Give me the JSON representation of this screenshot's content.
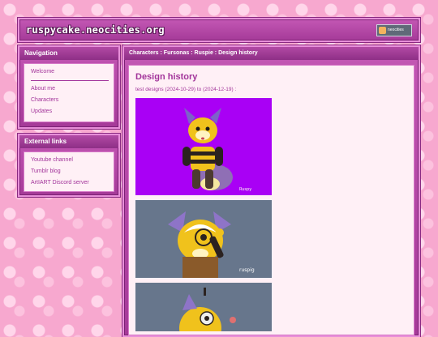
{
  "header": {
    "site_title": "ruspycake.neocities.org",
    "badge_label": "neocities"
  },
  "navigation": {
    "heading": "Navigation",
    "items": [
      {
        "label": "Welcome"
      },
      {
        "label": "About me"
      },
      {
        "label": "Characters"
      },
      {
        "label": "Updates"
      }
    ]
  },
  "external_links": {
    "heading": "External links",
    "items": [
      {
        "label": "Youtube channel"
      },
      {
        "label": "Tumblr blog"
      },
      {
        "label": "ArtIART Discord server"
      }
    ]
  },
  "main": {
    "breadcrumb": "Characters : Fursonas : Ruspie : Design history",
    "title": "Design history",
    "subtitle": "test designs (2024-10-29) to (2024-12-19) :",
    "artworks": [
      {
        "background": "#a900f5",
        "signature": "Ruspy"
      },
      {
        "background": "#67768c",
        "signature": "ruspig"
      },
      {
        "background": "#67768c"
      }
    ]
  },
  "colors": {
    "accent": "#a2349a",
    "panel": "#b24aa5",
    "content_bg": "#fff0f6",
    "page_bg": "#f7a8cf"
  }
}
